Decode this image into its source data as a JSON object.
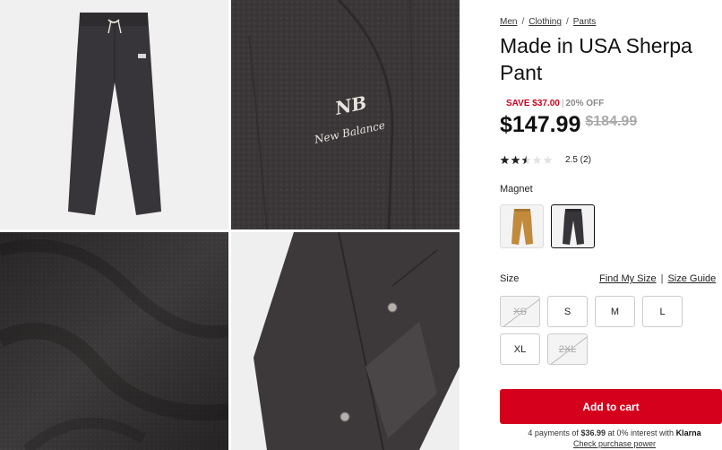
{
  "breadcrumb": [
    "Men",
    "Clothing",
    "Pants"
  ],
  "product": {
    "title": "Made in USA Sherpa Pant",
    "save_text": "SAVE $37.00",
    "discount": "20% OFF",
    "price": "$147.99",
    "original_price": "$184.99",
    "rating_value": 2.5,
    "rating_text": "2.5 (2)"
  },
  "color": {
    "label": "Magnet",
    "options": [
      "tan",
      "magnet"
    ],
    "selected": "magnet"
  },
  "size": {
    "label": "Size",
    "find_my_size": "Find My Size",
    "separator": "|",
    "size_guide": "Size Guide",
    "options": [
      {
        "label": "XS",
        "available": false
      },
      {
        "label": "S",
        "available": true
      },
      {
        "label": "M",
        "available": true
      },
      {
        "label": "L",
        "available": true
      },
      {
        "label": "XL",
        "available": true
      },
      {
        "label": "2XL",
        "available": false
      }
    ]
  },
  "cart": {
    "label": "Add to cart"
  },
  "klarna": {
    "prefix": "4 payments of",
    "amount": "$36.99",
    "suffix": "at 0% interest with",
    "brand": "Klarna",
    "link": "Check purchase power"
  },
  "gallery": {
    "logo_text": "New Balance",
    "logo_mark": "NB"
  },
  "colors": {
    "accent": "#d5001c",
    "fabric": "#3a3637",
    "tan": "#c28a3c"
  }
}
